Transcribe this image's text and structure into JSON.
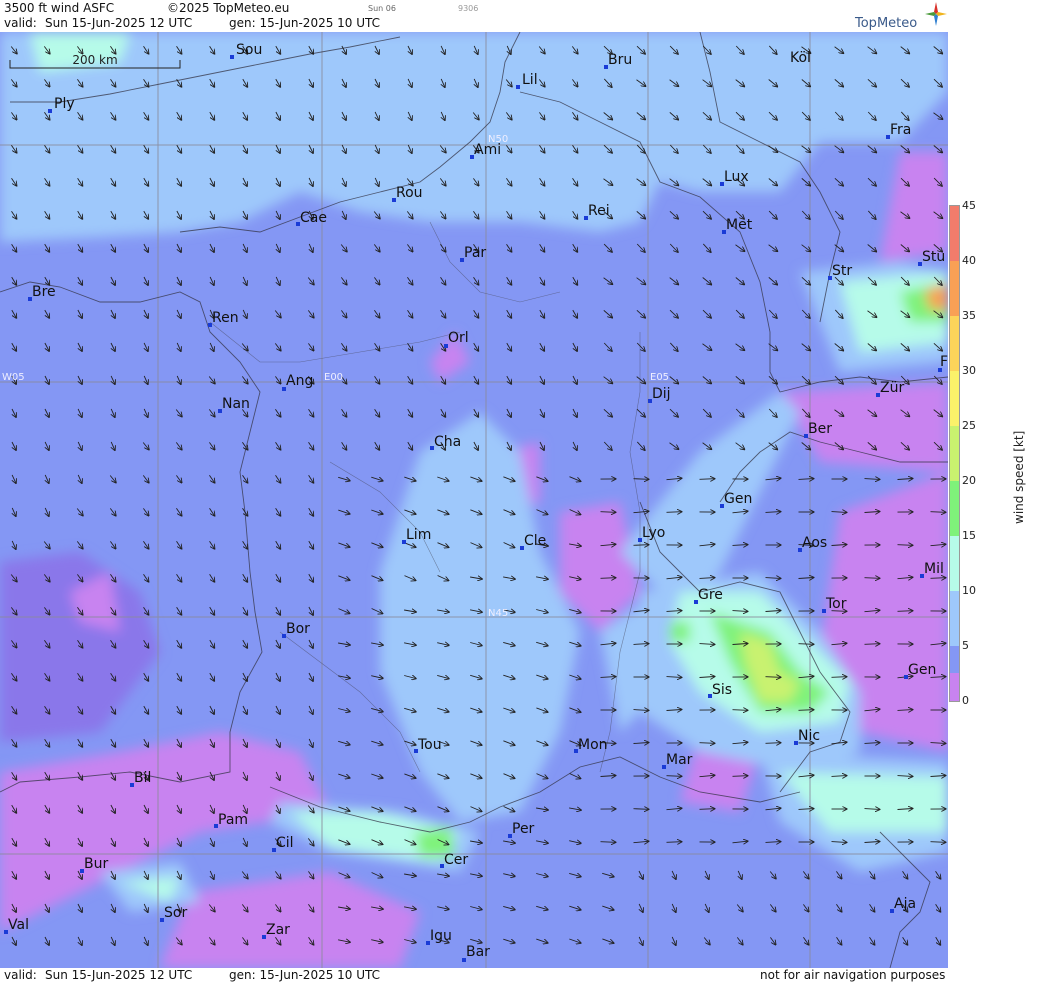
{
  "header": {
    "product": "3500 ft wind ASFC",
    "copyright": "©2025 TopMeteo.eu",
    "small_day": "Sun 06",
    "small_code": "9306",
    "valid_label": "valid:",
    "valid_value": "Sun  15-Jun-2025  12 UTC",
    "gen_value": "gen: 15-Jun-2025 10 UTC",
    "logo_text": "TopMeteo"
  },
  "footer": {
    "valid_label": "valid:",
    "valid_value": "Sun  15-Jun-2025  12 UTC",
    "gen_value": "gen: 15-Jun-2025 10 UTC",
    "disclaimer": "not for air navigation purposes"
  },
  "scale_bar": {
    "label": "200 km"
  },
  "colorbar": {
    "title": "wind speed [kt]",
    "ticks": [
      "45",
      "40",
      "35",
      "30",
      "25",
      "20",
      "15",
      "10",
      "5",
      "0"
    ],
    "colors": [
      "#f27c6b",
      "#f9a055",
      "#fcd45a",
      "#fbf26a",
      "#c9f26f",
      "#7ff27a",
      "#b6fbe9",
      "#ccecff",
      "#9ec8fb",
      "#8497f4",
      "#8a77ea",
      "#c883f0"
    ]
  },
  "grid_labels": {
    "n50": "N50",
    "n45": "N45",
    "w05": "W05",
    "e00": "E00",
    "e05": "E05"
  },
  "cities": {
    "sou": "Sou",
    "bru": "Bru",
    "kol": "Köl",
    "ply": "Ply",
    "lil": "Lil",
    "ami": "Ami",
    "fra": "Fra",
    "lux": "Lux",
    "rou": "Rou",
    "cae": "Cae",
    "rei": "Rei",
    "met": "Met",
    "par": "Par",
    "stu": "Stu",
    "str": "Str",
    "bre": "Bre",
    "ren": "Ren",
    "orl": "Orl",
    "ang": "Ang",
    "dij": "Dij",
    "zur": "Zür",
    "nan": "Nan",
    "ber": "Ber",
    "cha": "Cha",
    "gen": "Gen",
    "lim": "Lim",
    "cle": "Cle",
    "lyo": "Lyo",
    "aos": "Aos",
    "mil": "Mil",
    "gre": "Gre",
    "tor": "Tor",
    "bor": "Bor",
    "gen2": "Gen",
    "sis": "Sis",
    "nic": "Nic",
    "tou": "Tou",
    "mon": "Mon",
    "mar": "Mar",
    "bil": "Bil",
    "pam": "Pam",
    "cil": "Cil",
    "per": "Per",
    "bur": "Bur",
    "cer": "Cer",
    "sor": "Sor",
    "aja": "Aja",
    "val": "Val",
    "zar": "Zar",
    "igu": "Igu",
    "bar": "Bar",
    "f_edge": "F"
  }
}
